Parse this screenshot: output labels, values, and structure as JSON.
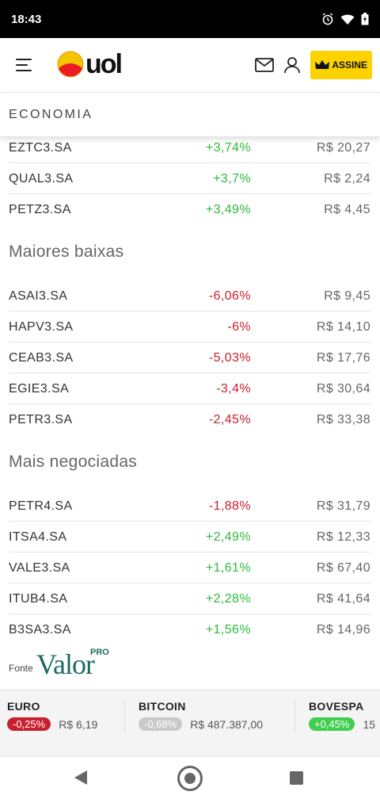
{
  "status_bar": {
    "time": "18:43"
  },
  "header": {
    "logo_text": "uol",
    "subscribe_label": "ASSINE"
  },
  "section": {
    "title": "ECONOMIA"
  },
  "top_rows": [
    {
      "symbol": "EZTC3.SA",
      "change": "+3,74%",
      "price": "R$ 20,27",
      "dir": "up"
    },
    {
      "symbol": "QUAL3.SA",
      "change": "+3,7%",
      "price": "R$ 2,24",
      "dir": "up"
    },
    {
      "symbol": "PETZ3.SA",
      "change": "+3,49%",
      "price": "R$ 4,45",
      "dir": "up"
    }
  ],
  "losers": {
    "title": "Maiores baixas",
    "rows": [
      {
        "symbol": "ASAI3.SA",
        "change": "-6,06%",
        "price": "R$ 9,45",
        "dir": "down"
      },
      {
        "symbol": "HAPV3.SA",
        "change": "-6%",
        "price": "R$ 14,10",
        "dir": "down"
      },
      {
        "symbol": "CEAB3.SA",
        "change": "-5,03%",
        "price": "R$ 17,76",
        "dir": "down"
      },
      {
        "symbol": "EGIE3.SA",
        "change": "-3,4%",
        "price": "R$ 30,64",
        "dir": "down"
      },
      {
        "symbol": "PETR3.SA",
        "change": "-2,45%",
        "price": "R$ 33,38",
        "dir": "down"
      }
    ]
  },
  "most_traded": {
    "title": "Mais negociadas",
    "rows": [
      {
        "symbol": "PETR4.SA",
        "change": "-1,88%",
        "price": "R$ 31,79",
        "dir": "down"
      },
      {
        "symbol": "ITSA4.SA",
        "change": "+2,49%",
        "price": "R$ 12,33",
        "dir": "up"
      },
      {
        "symbol": "VALE3.SA",
        "change": "+1,61%",
        "price": "R$ 67,40",
        "dir": "up"
      },
      {
        "symbol": "ITUB4.SA",
        "change": "+2,28%",
        "price": "R$ 41,64",
        "dir": "up"
      },
      {
        "symbol": "B3SA3.SA",
        "change": "+1,56%",
        "price": "R$ 14,96",
        "dir": "up"
      }
    ]
  },
  "source": {
    "label": "Fonte",
    "brand": "Valor",
    "brand_suffix": "PRO"
  },
  "ticker": [
    {
      "name": "EURO",
      "change": "-0,25%",
      "value": "R$ 6,19",
      "state": "down"
    },
    {
      "name": "BITCOIN",
      "change": "-0,68%",
      "value": "R$ 487.387,00",
      "state": "neutral"
    },
    {
      "name": "BOVESPA",
      "change": "+0,45%",
      "value": "15",
      "state": "up"
    }
  ]
}
